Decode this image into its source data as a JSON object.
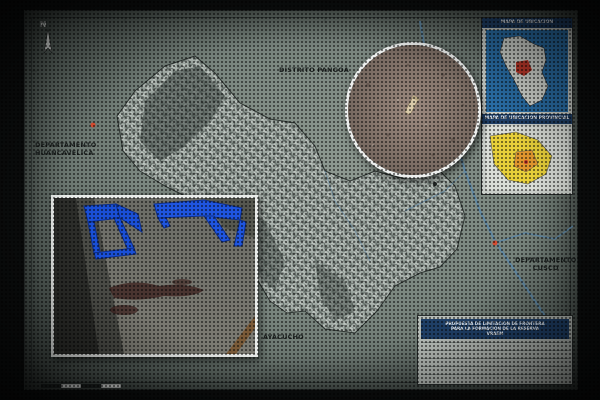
{
  "map": {
    "district_label": "DISTRITO PANGOA",
    "dept_huancavelica_line1": "DEPARTAMENTO",
    "dept_huancavelica_line2": "HUANCAVELICA",
    "dept_cusco_line1": "DEPARTAMENTO",
    "dept_cusco_line2": "CUSCO",
    "ayacucho_label": "AYACUCHO",
    "north_letter": "N"
  },
  "insets": {
    "peru_title": "MAPA DE UBICACION DEPARTAMENTAL",
    "region_title": "MAPA DE UBICACION PROVINCIAL"
  },
  "title_block": {
    "heading_line1": "PROPUESTA DE LIMITACION DE FRONTERA",
    "heading_line2": "PARA LA FORMACION DE LA RESERVA",
    "heading_line3": "VRAEM"
  },
  "colors": {
    "region_yellow": "#e7cf3a",
    "peru_red": "#c0392b",
    "title_blue": "#1f3f66",
    "chair_blue": "#1a4fd6"
  },
  "photos": {
    "crime_scene": "blue plastic chairs overturned on concrete floor with blood stains",
    "bullet": "bullet casing on dirt ground"
  }
}
